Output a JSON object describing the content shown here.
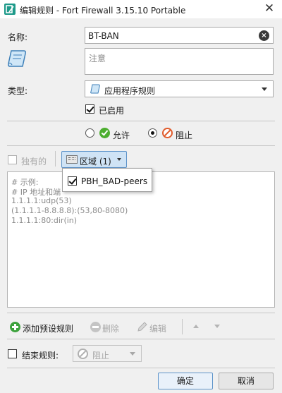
{
  "window": {
    "title": "编辑规则 - Fort Firewall 3.15.10 Portable",
    "close": "✕"
  },
  "form": {
    "name_label": "名称:",
    "name_value": "BT-BAN",
    "notes_placeholder": "注意",
    "type_label": "类型:",
    "type_value": "应用程序规则",
    "enabled_label": "已启用",
    "enabled_checked": true
  },
  "action": {
    "allow_label": "允许",
    "block_label": "阻止",
    "selected": "block"
  },
  "zones": {
    "exclusive_label": "独有的",
    "exclusive_checked": false,
    "zone_button_label": "区域 (1)",
    "dropdown_items": [
      {
        "label": "PBH_BAD-peers",
        "checked": true
      }
    ]
  },
  "rules_text": {
    "lines": [
      "# 示例:",
      "# IP 地址和端",
      "1.1.1.1:udp(53)",
      "(1.1.1.1-8.8.8.8):(53,80-8080)",
      "1.1.1.1:80:dir(in)"
    ]
  },
  "toolbar": {
    "add_preset_label": "添加预设规则",
    "delete_label": "删除",
    "edit_label": "编辑"
  },
  "terminate": {
    "label": "结束规则:",
    "checked": false,
    "action_value": "阻止"
  },
  "buttons": {
    "ok_label": "确定",
    "cancel_label": "取消"
  },
  "colors": {
    "accent_border": "#5d93c9",
    "zone_button_bg": "#cfe3f5",
    "allow_green": "#4cae2f",
    "block_orange": "#e05a2a",
    "add_green": "#3ca23c"
  }
}
